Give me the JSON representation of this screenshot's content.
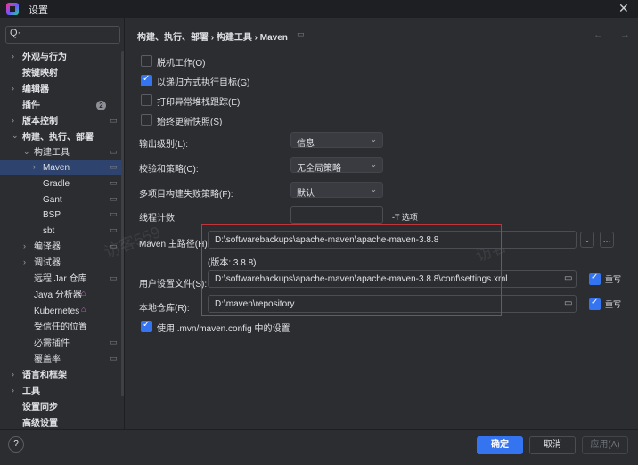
{
  "window": {
    "title": "设置",
    "close": "✕"
  },
  "search": {
    "icon": "Q·"
  },
  "sidebar": {
    "items": [
      {
        "label": "外观与行为",
        "arrow": "›"
      },
      {
        "label": "按键映射"
      },
      {
        "label": "编辑器",
        "arrow": "›"
      },
      {
        "label": "插件",
        "badge": "2"
      },
      {
        "label": "版本控制",
        "arrow": "›"
      },
      {
        "label": "构建、执行、部署",
        "arrow": "⌄"
      },
      {
        "label": "构建工具",
        "arrow": "⌄"
      },
      {
        "label": "Maven",
        "arrow": "›"
      },
      {
        "label": "Gradle"
      },
      {
        "label": "Gant"
      },
      {
        "label": "BSP"
      },
      {
        "label": "sbt"
      },
      {
        "label": "编译器",
        "arrow": "›"
      },
      {
        "label": "调试器",
        "arrow": "›"
      },
      {
        "label": "远程 Jar 仓库"
      },
      {
        "label": "Java 分析器"
      },
      {
        "label": "Kubernetes"
      },
      {
        "label": "受信任的位置"
      },
      {
        "label": "必需插件"
      },
      {
        "label": "覆盖率"
      },
      {
        "label": "语言和框架",
        "arrow": "›"
      },
      {
        "label": "工具",
        "arrow": "›"
      },
      {
        "label": "设置同步"
      },
      {
        "label": "高级设置"
      }
    ]
  },
  "breadcrumb": {
    "text": "构建、执行、部署  ›  构建工具  ›  Maven"
  },
  "nav": {
    "arrows": "← →"
  },
  "options": {
    "offline": "脱机工作(O)",
    "recursive": "以递归方式执行目标(G)",
    "stacktrace": "打印异常堆栈跟踪(E)",
    "update_snapshots": "始终更新快照(S)",
    "output_level_label": "输出级别(L):",
    "output_level_value": "信息",
    "checksum_label": "校验和策略(C):",
    "checksum_value": "无全局策略",
    "multi_label": "多项目构建失败策略(F):",
    "multi_value": "默认",
    "threads_label": "线程计数",
    "threads_value": "",
    "threads_hint": "-T 选项",
    "home_label": "Maven 主路径(H):",
    "home_value": "D:\\softwarebackups\\apache-maven\\apache-maven-3.8.8",
    "version": "(版本: 3.8.8)",
    "user_settings_label": "用户设置文件(S):",
    "user_settings_value": "D:\\softwarebackups\\apache-maven\\apache-maven-3.8.8\\conf\\settings.xml",
    "override": "重写",
    "local_repo_label": "本地仓库(R):",
    "local_repo_value": "D:\\maven\\repository",
    "use_mvn_config": "使用 .mvn/maven.config 中的设置"
  },
  "watermark": {
    "text": "访客559"
  },
  "footer": {
    "help": "?",
    "ok": "确定",
    "cancel": "取消",
    "apply": "应用(A)"
  }
}
